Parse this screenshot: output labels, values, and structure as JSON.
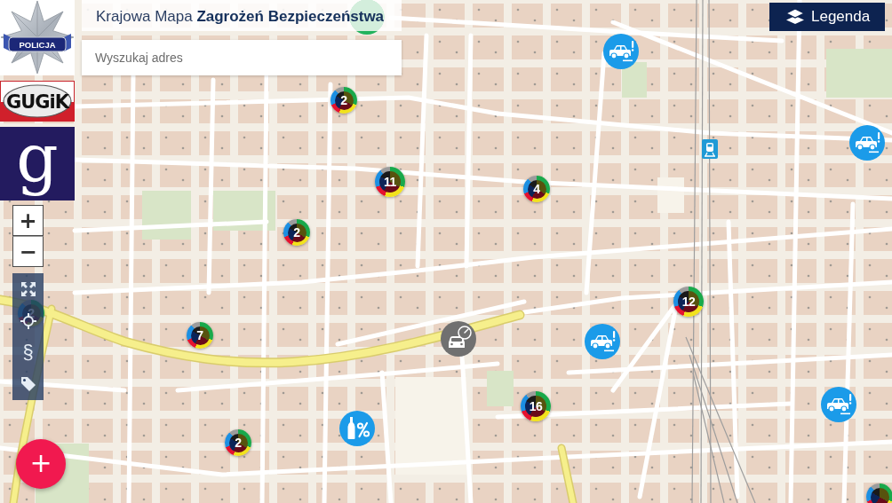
{
  "logos": [
    {
      "kind": "police",
      "text": "POLICJA"
    },
    {
      "kind": "gugik",
      "text": "GUGiK"
    },
    {
      "kind": "geoportal",
      "text": "g"
    }
  ],
  "header": {
    "title": "Krajowa Mapa **Zagrożeń Bezpieczeństwa**"
  },
  "search": {
    "placeholder": "Wyszukaj adres"
  },
  "legend_button": {
    "label": "Legenda"
  },
  "zoom_controls": [
    {
      "label": "+"
    },
    {
      "label": "−"
    }
  ],
  "toolbar": [
    {
      "kind": "fullscreen"
    },
    {
      "kind": "locate"
    },
    {
      "kind": "symbol",
      "label": "§"
    },
    {
      "kind": "tags"
    }
  ],
  "add_button": {
    "label": "+"
  },
  "markers": [
    {
      "kind": "poi"
    },
    {
      "kind": "car_alert"
    },
    {
      "kind": "cluster",
      "count": "2"
    },
    {
      "kind": "car_alert"
    },
    {
      "kind": "cluster",
      "count": "11"
    },
    {
      "kind": "cluster",
      "count": "4"
    },
    {
      "kind": "cluster",
      "count": "2"
    },
    {
      "kind": "cluster",
      "count": "12"
    },
    {
      "kind": "cluster",
      "count": "2"
    },
    {
      "kind": "cluster",
      "count": "7"
    },
    {
      "kind": "speed"
    },
    {
      "kind": "car_alert"
    },
    {
      "kind": "car_alert"
    },
    {
      "kind": "cluster",
      "count": "16"
    },
    {
      "kind": "alcohol"
    },
    {
      "kind": "cluster",
      "count": "2"
    },
    {
      "kind": "cluster"
    }
  ]
}
